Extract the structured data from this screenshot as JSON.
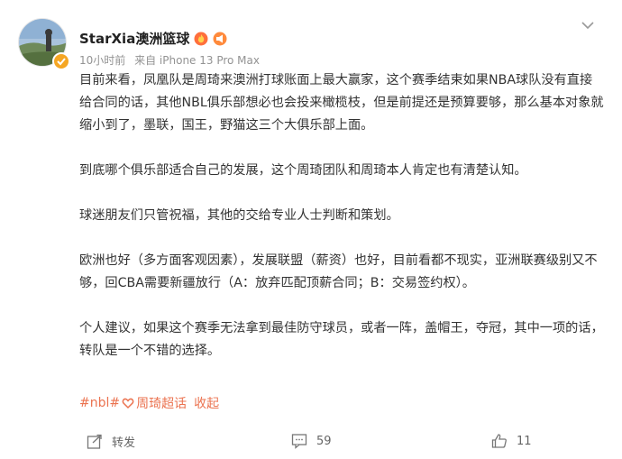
{
  "post": {
    "author": {
      "name": "StarXia澳洲篮球",
      "avatar_icon": "avatar-photo",
      "verified_icon": "verified-badge-icon",
      "badges": [
        "fire-badge-icon",
        "loudspeaker-badge-icon"
      ]
    },
    "meta": {
      "time": "10小时前",
      "source": "来自 iPhone 13 Pro Max"
    },
    "paragraphs": [
      "目前来看，凤凰队是周琦来澳洲打球账面上最大赢家，这个赛季结束如果NBA球队没有直接给合同的话，其他NBL俱乐部想必也会投来橄榄枝，但是前提还是预算要够，那么基本对象就缩小到了，墨联，国王，野猫这三个大俱乐部上面。",
      "到底哪个俱乐部适合自己的发展，这个周琦团队和周琦本人肯定也有清楚认知。",
      "球迷朋友们只管祝福，其他的交给专业人士判断和策划。",
      "欧洲也好（多方面客观因素），发展联盟（薪资）也好，目前看都不现实，亚洲联赛级别又不够，回CBA需要新疆放行（A：放弃匹配顶薪合同；B：交易签约权）。",
      "个人建议，如果这个赛季无法拿到最佳防守球员，或者一阵，盖帽王，夺冠，其中一项的话，转队是一个不错的选择。"
    ],
    "tags": {
      "hashtag": "#nbl#",
      "super_topic": "周琦超话",
      "collapse": "收起"
    },
    "actions": {
      "repost_label": "转发",
      "comment_count": "59",
      "like_count": "11"
    }
  },
  "colors": {
    "accent": "#eb7350",
    "text": "#333333",
    "meta": "#939393"
  }
}
